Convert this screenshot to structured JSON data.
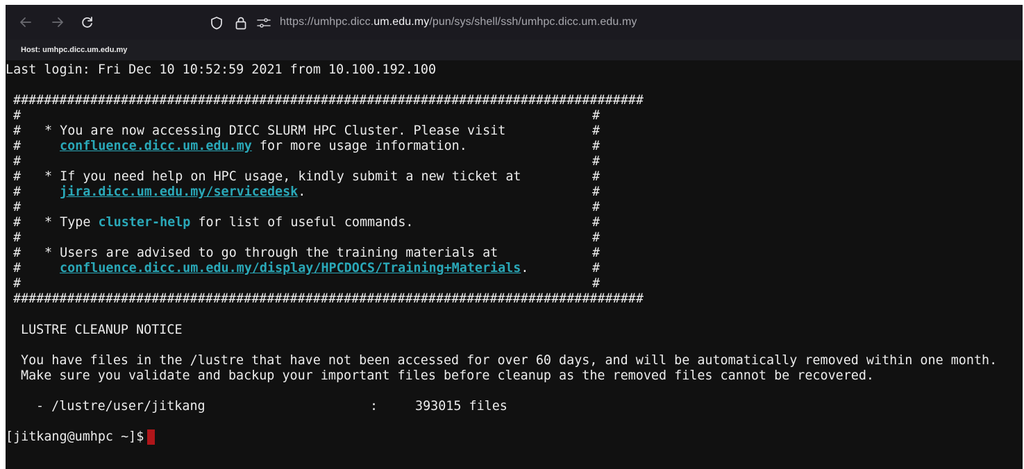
{
  "browser": {
    "url_prefix": "https://umhpc.dicc.",
    "url_domain": "um.edu.my",
    "url_path": "/pun/sys/shell/ssh/umhpc.dicc.um.edu.my",
    "icons": [
      "back-arrow-icon",
      "forward-arrow-icon",
      "reload-icon",
      "shield-icon",
      "lock-icon",
      "permissions-icon"
    ]
  },
  "host_label": "Host: umhpc.dicc.um.edu.my",
  "terminal": {
    "last_login": "Last login: Fri Dec 10 10:52:59 2021 from 10.100.192.100",
    "banner_border": "##################################################################################",
    "banner": {
      "line1": "* You are now accessing DICC SLURM HPC Cluster. Please visit",
      "link1": "confluence.dicc.um.edu.my",
      "line1b_rest": " for more usage information.",
      "line2": "* If you need help on HPC usage, kindly submit a new ticket at",
      "link2": "jira.dicc.um.edu.my/servicedesk",
      "link2_suffix": ".",
      "line3_pre": "* Type ",
      "line3_cmd": "cluster-help",
      "line3_post": " for list of useful commands.",
      "line4": "* Users are advised to go through the training materials at",
      "link4": "confluence.dicc.um.edu.my/display/HPCDOCS/Training+Materials",
      "link4_suffix": "."
    },
    "notice_title": "LUSTRE CLEANUP NOTICE",
    "notice_line1": "You have files in the /lustre that have not been accessed for over 60 days, and will be automatically removed within one month.",
    "notice_line2": "Make sure you validate and backup your important files before cleanup as the removed files cannot be recovered.",
    "file_path": "- /lustre/user/jitkang",
    "file_sep": ":",
    "file_count": "393015 files",
    "prompt": "[jitkang@umhpc ~]$",
    "cursor_color": "#b0161a",
    "link_color": "#2aa8b8"
  }
}
